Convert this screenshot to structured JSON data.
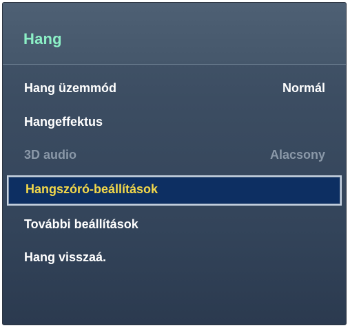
{
  "header": {
    "title": "Hang"
  },
  "menu": {
    "items": [
      {
        "label": "Hang üzemmód",
        "value": "Normál",
        "state": "normal"
      },
      {
        "label": "Hangeffektus",
        "value": "",
        "state": "normal"
      },
      {
        "label": "3D audio",
        "value": "Alacsony",
        "state": "disabled"
      },
      {
        "label": "Hangszóró-beállítások",
        "value": "",
        "state": "selected"
      },
      {
        "label": "További beállítások",
        "value": "",
        "state": "normal"
      },
      {
        "label": "Hang visszaá.",
        "value": "",
        "state": "normal"
      }
    ]
  },
  "colors": {
    "title": "#8cf0c6",
    "selected_text": "#f3d84a",
    "selected_bg": "#0d2f62",
    "disabled_text": "#8a98a8",
    "panel_bg": "#3c4d62"
  }
}
